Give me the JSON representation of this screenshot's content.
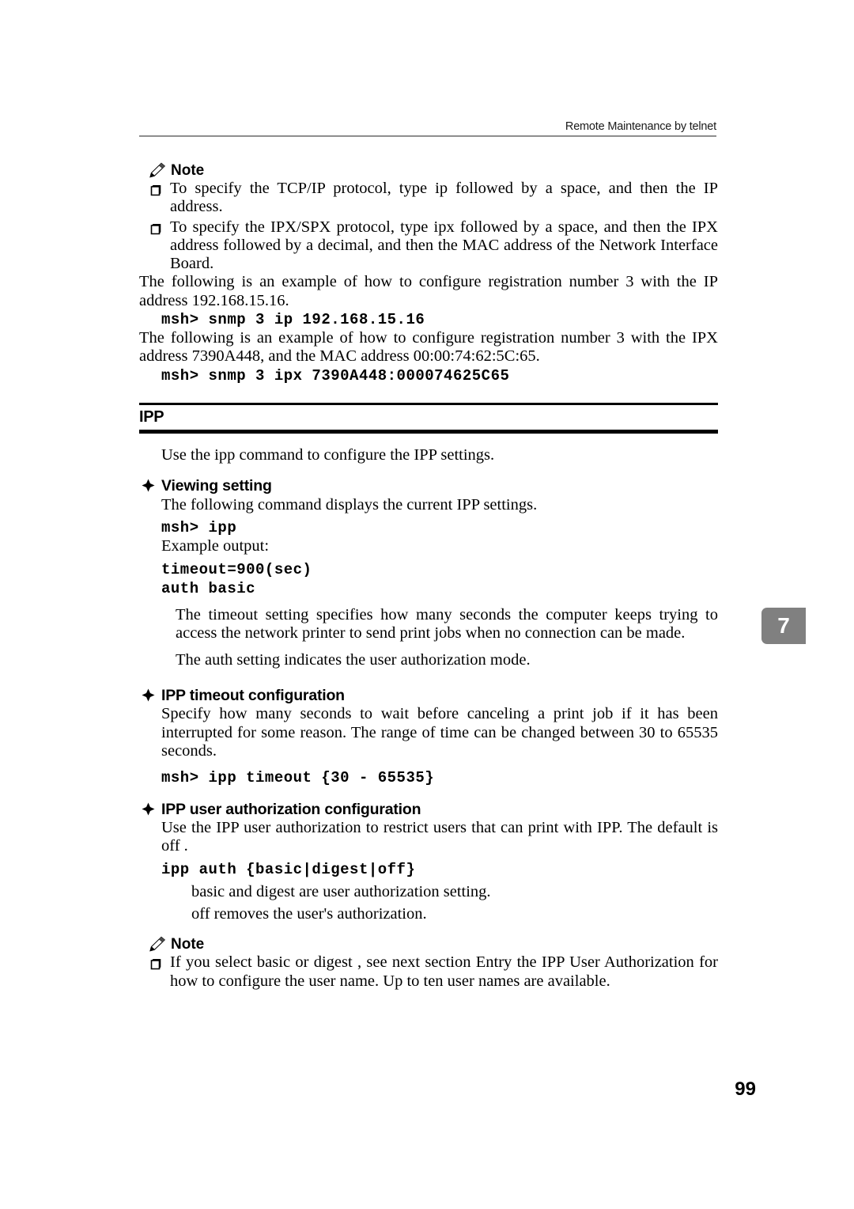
{
  "header": {
    "running_head": "Remote Maintenance by telnet"
  },
  "note_top": {
    "label": "Note",
    "icon": "pencil-note-icon",
    "items": [
      "To specify the TCP/IP protocol, type ip followed by a space, and then the IP address.",
      "To specify the IPX/SPX protocol, type ipx followed by a space, and then the IPX address followed by a decimal, and then the MAC address of the Network Interface Board."
    ]
  },
  "snmp_examples": {
    "intro_ip": "The following is an example of how to configure registration number 3 with the IP address 192.168.15.16.",
    "command_ip": "msh> snmp 3 ip 192.168.15.16",
    "intro_ipx": "The following is an example of how to configure registration number 3 with the IPX address 7390A448, and the MAC address 00:00:74:62:5C:65.",
    "command_ipx": "msh> snmp 3 ipx 7390A448:000074625C65"
  },
  "ipp_section": {
    "title": "IPP",
    "intro": "Use the ipp command to configure the IPP settings.",
    "viewing": {
      "heading": "Viewing setting",
      "bullet": "diamond-bullet-icon",
      "description": "The following command displays the current IPP settings.",
      "command": "msh> ipp",
      "example_label": "Example output:",
      "output_line1": "timeout=900(sec)",
      "output_line2": "auth basic",
      "explain_timeout": "The  timeout  setting specifies how many seconds the computer keeps trying to access the network printer to send print jobs when no connection can be made.",
      "explain_auth": "The  auth  setting indicates the user authorization mode."
    },
    "timeout_config": {
      "heading": "IPP timeout configuration",
      "bullet": "diamond-bullet-icon",
      "description": "Specify how many seconds to wait before canceling a print job if it has been interrupted for some reason. The range of time can be changed between 30 to 65535 seconds.",
      "command": "msh> ipp timeout {30 - 65535}"
    },
    "auth_config": {
      "heading": "IPP user authorization configuration",
      "bullet": "diamond-bullet-icon",
      "description": "Use the IPP user authorization to restrict users that can print with IPP. The default is  off  .",
      "command": "ipp auth {basic|digest|off}",
      "note_basic_digest": "basic  and  digest  are user authorization setting.",
      "note_off": "off  removes the user's authorization."
    }
  },
  "note_bottom": {
    "label": "Note",
    "icon": "pencil-note-icon",
    "items": [
      "If you select  basic  or  digest , see next section  Entry the IPP User Authorization  for how to configure the user name. Up to ten user names are available."
    ]
  },
  "thumb_tab": {
    "chapter": "7",
    "color": "#808080"
  },
  "folio": {
    "page_number": "99"
  }
}
